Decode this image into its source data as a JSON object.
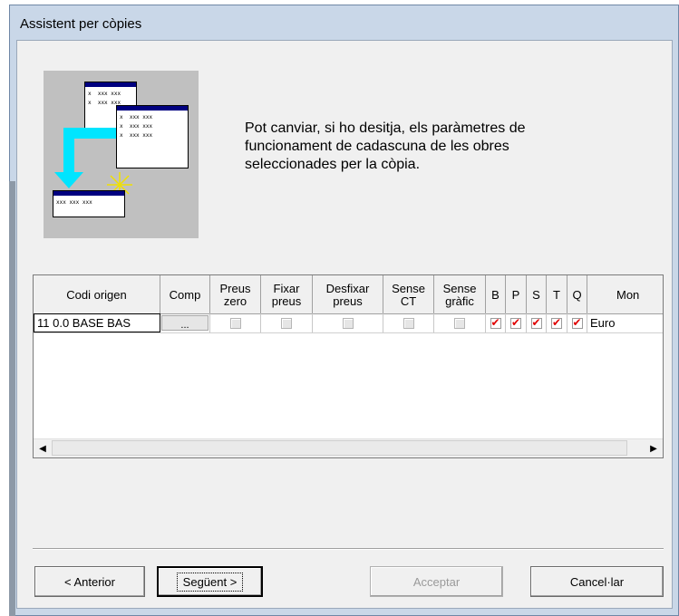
{
  "window": {
    "title": "Assistent per còpies"
  },
  "illustration": {
    "back_window_rows": [
      "x  xxx xxx",
      "x  xxx xxx"
    ],
    "front_window_rows": [
      "x  xxx xxx",
      "x  xxx xxx",
      "x  xxx xxx"
    ],
    "target_window_rows": [
      "xxx xxx xxx"
    ]
  },
  "info": {
    "text": "Pot canviar, si ho desitja, els paràmetres de funcionament de cadascuna de les obres seleccionades per la còpia."
  },
  "grid": {
    "headers": [
      "Codi origen",
      "Comp",
      "Preus\nzero",
      "Fixar\npreus",
      "Desfixar\npreus",
      "Sense\nCT",
      "Sense\ngràfic",
      "B",
      "P",
      "S",
      "T",
      "Q",
      "Mon"
    ],
    "rows": [
      {
        "codi": "11 0.0 BASE BAS",
        "comp": "...",
        "preus_zero": false,
        "fixar_preus": false,
        "desfixar_preus": false,
        "sense_ct": false,
        "sense_grafic": false,
        "b": true,
        "p": true,
        "s": true,
        "t": true,
        "q": true,
        "mon": "Euro"
      }
    ],
    "scroll_left": "◀",
    "scroll_right": "▶"
  },
  "buttons": {
    "anterior": "< Anterior",
    "seguent": "Següent >",
    "acceptar": "Acceptar",
    "cancellar": "Cancel·lar"
  }
}
